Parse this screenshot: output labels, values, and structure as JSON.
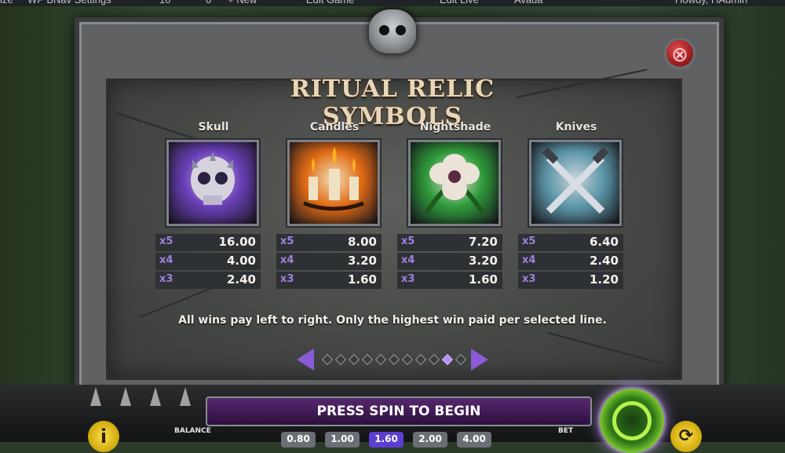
{
  "adminbar": {
    "items": [
      "ize",
      "WP BNav Settings",
      "10",
      "0",
      "+ New",
      "Edit Game",
      "Edit Live",
      "Avada",
      "Howdy, HAdmin"
    ]
  },
  "title": "RITUAL RELIC SYMBOLS",
  "close_label": "⊗",
  "symbols": [
    {
      "name": "Skull",
      "pays": [
        {
          "mult": "x5",
          "value": "16.00"
        },
        {
          "mult": "x4",
          "value": "4.00"
        },
        {
          "mult": "x3",
          "value": "2.40"
        }
      ],
      "colors": {
        "bg": "#6a3fb8",
        "accent": "#c9c4d8"
      }
    },
    {
      "name": "Candles",
      "pays": [
        {
          "mult": "x5",
          "value": "8.00"
        },
        {
          "mult": "x4",
          "value": "3.20"
        },
        {
          "mult": "x3",
          "value": "1.60"
        }
      ],
      "colors": {
        "bg": "#e06a14",
        "accent": "#f1dfb6"
      }
    },
    {
      "name": "Nightshade",
      "pays": [
        {
          "mult": "x5",
          "value": "7.20"
        },
        {
          "mult": "x4",
          "value": "3.20"
        },
        {
          "mult": "x3",
          "value": "1.60"
        }
      ],
      "colors": {
        "bg": "#2e9a3a",
        "accent": "#eee6da"
      }
    },
    {
      "name": "Knives",
      "pays": [
        {
          "mult": "x5",
          "value": "6.40"
        },
        {
          "mult": "x4",
          "value": "2.40"
        },
        {
          "mult": "x3",
          "value": "1.20"
        }
      ],
      "colors": {
        "bg": "#5c96a8",
        "accent": "#c9d3da"
      }
    }
  ],
  "rule_text": "All wins pay left to right. Only the highest win paid per selected line.",
  "pager": {
    "count": 11,
    "active_index": 9
  },
  "bottom": {
    "banner": "PRESS SPIN TO BEGIN",
    "balance_label": "BALANCE",
    "bet_label": "BET",
    "info_label": "i",
    "bet_options": [
      "0.80",
      "1.00",
      "1.60",
      "2.00",
      "4.00"
    ],
    "bet_active_index": 2
  },
  "colors": {
    "accent": "#8a5ad8",
    "spin": "#6fd02a",
    "title": "#e8d6b8"
  }
}
